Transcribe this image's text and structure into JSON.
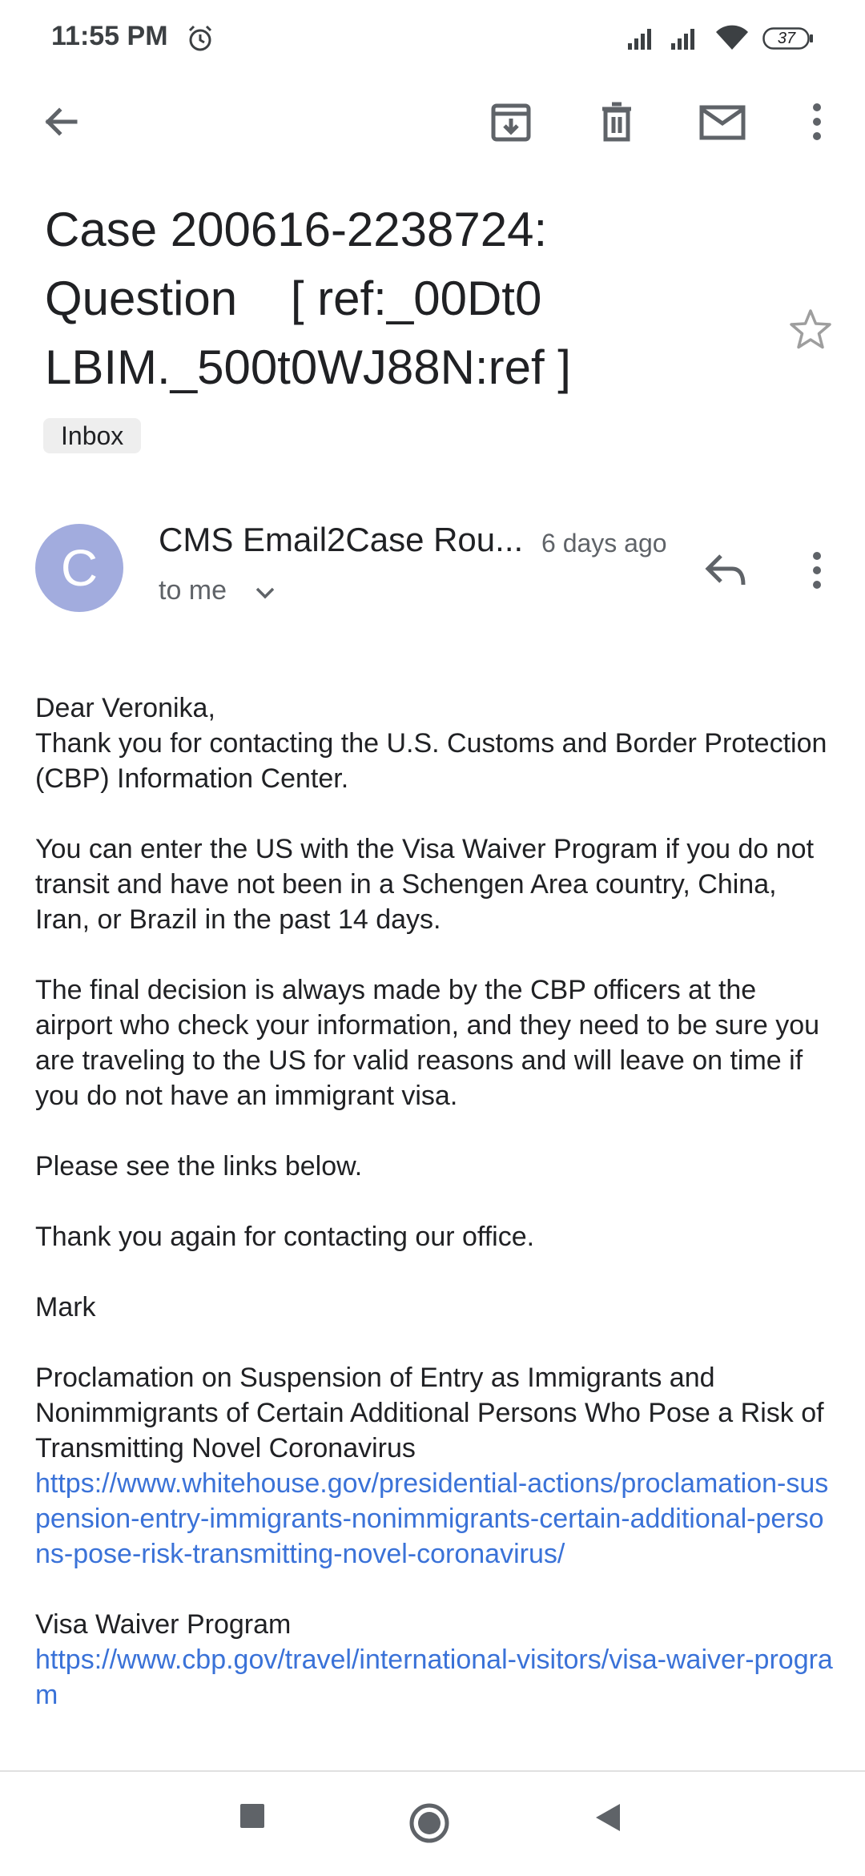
{
  "status_bar": {
    "time": "11:55 PM",
    "battery": "37"
  },
  "toolbar": {
    "back": "back-arrow-icon",
    "archive": "archive-icon",
    "delete": "trash-icon",
    "mark_unread": "mail-icon",
    "more": "more-vert-icon"
  },
  "email": {
    "subject_line1": "Case 200616-2238724:",
    "subject_line2": "Question    [ ref:_00Dt0",
    "subject_line3": "LBIM._500t0WJ88N:ref ]",
    "label": "Inbox",
    "sender_initial": "C",
    "sender_name": "CMS Email2Case Rou...",
    "time": "6 days ago",
    "recipient": "to me"
  },
  "body": {
    "greeting": "Dear Veronika,",
    "p1": "Thank you for contacting the U.S. Customs and Border Protection (CBP) Information Center.",
    "p2": "You can enter the US with the Visa Waiver Program if you do not transit and have not been in a Schengen Area country, China, Iran, or Brazil in the past 14 days.",
    "p3": "The final decision is always made by the CBP officers at the airport who check your information, and they need to be sure you are traveling to the US for valid reasons and will leave on time if you do not have an immigrant visa.",
    "p4": "Please see the links below.",
    "p5": "Thank you again for contacting our office.",
    "signature": "Mark",
    "link1_title": "Proclamation on Suspension of Entry as Immigrants and Nonimmigrants of Certain Additional Persons Who Pose a Risk of Transmitting Novel Coronavirus",
    "link1_url": "https://www.whitehouse.gov/presidential-actions/proclamation-suspension-entry-immigrants-nonimmigrants-certain-additional-persons-pose-risk-transmitting-novel-coronavirus/",
    "link2_title": "Visa Waiver Program",
    "link2_url": "https://www.cbp.gov/travel/international-visitors/visa-waiver-program"
  },
  "colors": {
    "link": "#3a72d8",
    "avatar": "#a2acde"
  }
}
